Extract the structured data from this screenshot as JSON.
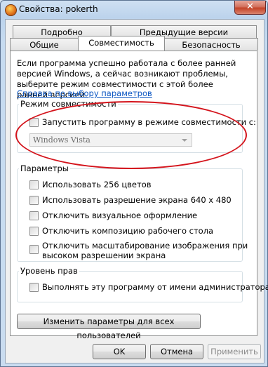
{
  "window": {
    "title": "Свойства: pokerth",
    "close_label": "✕"
  },
  "tabs": {
    "row1": [
      "Подробно",
      "Предыдущие версии"
    ],
    "row2": [
      "Общие",
      "Совместимость",
      "Безопасность"
    ],
    "active": "Совместимость"
  },
  "intro_text": "Если программа успешно работала с более ранней версией Windows, а сейчас возникают проблемы, выберите режим совместимости с этой более ранней версией.",
  "help_link": "Справка по выбору параметров",
  "compat_group": {
    "label": "Режим совместимости",
    "checkbox_label": "Запустить программу в режиме совместимости с:",
    "checked": false,
    "select_value": "Windows Vista",
    "highlight_color": "#d4141c"
  },
  "params_group": {
    "label": "Параметры",
    "options": [
      {
        "label": "Использовать 256 цветов",
        "checked": false
      },
      {
        "label": "Использовать разрешение экрана 640 x 480",
        "checked": false
      },
      {
        "label": "Отключить визуальное оформление",
        "checked": false
      },
      {
        "label": "Отключить композицию рабочего стола",
        "checked": false
      },
      {
        "label": "Отключить масштабирование изображения при",
        "label_line2": "высоком разрешении экрана",
        "checked": false
      }
    ]
  },
  "rights_group": {
    "label": "Уровень прав",
    "checkbox_label": "Выполнять эту программу от имени администратора",
    "checked": false
  },
  "all_users_button": "Изменить параметры для всех пользователей",
  "footer": {
    "ok": "OK",
    "cancel": "Отмена",
    "apply": "Применить"
  }
}
